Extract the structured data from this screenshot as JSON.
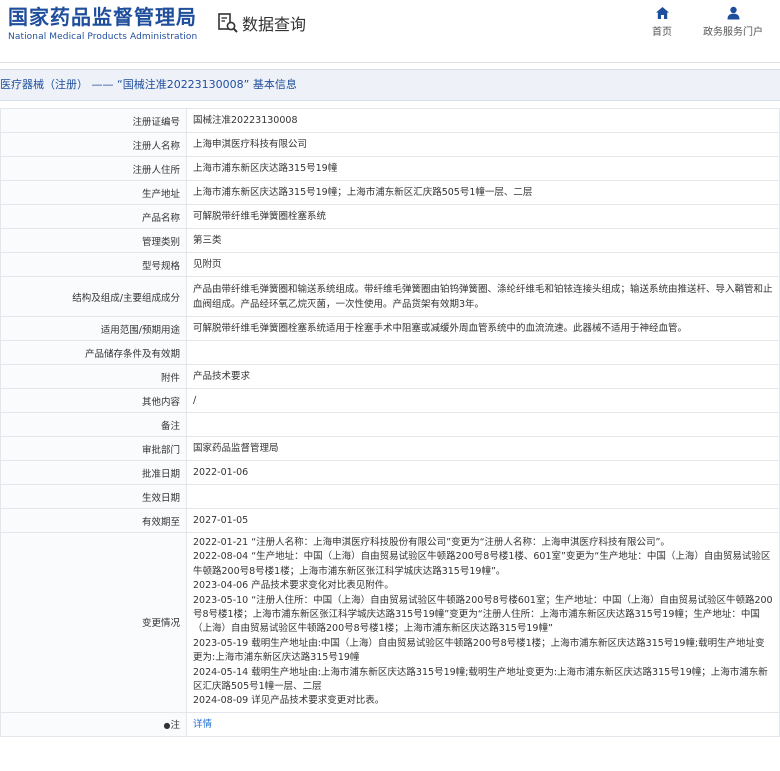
{
  "header": {
    "logo_cn": "国家药品监督管理局",
    "logo_en": "National Medical Products Administration",
    "query_title": "数据查询",
    "nav": [
      {
        "label": "首页",
        "icon": "home-icon"
      },
      {
        "label": "政务服务门户",
        "icon": "user-icon"
      }
    ]
  },
  "breadcrumb": "医疗器械（注册） —— “国械注准20223130008” 基本信息",
  "colors": {
    "brand": "#1f4e9c",
    "link": "#1f6fd1",
    "breadcrumb_bg": "#eef2f8"
  },
  "rows": [
    {
      "label": "注册证编号",
      "value": "国械注准20223130008"
    },
    {
      "label": "注册人名称",
      "value": "上海申淇医疗科技有限公司"
    },
    {
      "label": "注册人住所",
      "value": "上海市浦东新区庆达路315号19幢"
    },
    {
      "label": "生产地址",
      "value": "上海市浦东新区庆达路315号19幢；上海市浦东新区汇庆路505号1幢一层、二层"
    },
    {
      "label": "产品名称",
      "value": "可解脱带纤维毛弹簧圈栓塞系统"
    },
    {
      "label": "管理类别",
      "value": "第三类"
    },
    {
      "label": "型号规格",
      "value": "见附页"
    },
    {
      "label": "结构及组成/主要组成成分",
      "value": "产品由带纤维毛弹簧圈和输送系统组成。带纤维毛弹簧圈由铂钨弹簧圈、涤纶纤维毛和铂铱连接头组成；输送系统由推送杆、导入鞘管和止血阀组成。产品经环氧乙烷灭菌，一次性使用。产品货架有效期3年。"
    },
    {
      "label": "适用范围/预期用途",
      "value": "可解脱带纤维毛弹簧圈栓塞系统适用于栓塞手术中阻塞或减缓外周血管系统中的血流流速。此器械不适用于神经血管。"
    },
    {
      "label": "产品储存条件及有效期",
      "value": ""
    },
    {
      "label": "附件",
      "value": "产品技术要求"
    },
    {
      "label": "其他内容",
      "value": "/"
    },
    {
      "label": "备注",
      "value": ""
    },
    {
      "label": "审批部门",
      "value": "国家药品监督管理局"
    },
    {
      "label": "批准日期",
      "value": "2022-01-06"
    },
    {
      "label": "生效日期",
      "value": ""
    },
    {
      "label": "有效期至",
      "value": "2027-01-05"
    }
  ],
  "change_label": "变更情况",
  "changes": [
    "2022-01-21 “注册人名称：上海申淇医疗科技股份有限公司”变更为“注册人名称：上海申淇医疗科技有限公司”。",
    "2022-08-04 “生产地址：中国（上海）自由贸易试验区牛顿路200号8号楼1楼、601室”变更为“生产地址：中国（上海）自由贸易试验区牛顿路200号8号楼1楼；上海市浦东新区张江科学城庆达路315号19幢”。",
    "2023-04-06 产品技术要求变化对比表见附件。",
    "2023-05-10 “注册人住所：中国（上海）自由贸易试验区牛顿路200号8号楼601室；生产地址：中国（上海）自由贸易试验区牛顿路200号8号楼1楼；上海市浦东新区张江科学城庆达路315号19幢”变更为“注册人住所：上海市浦东新区庆达路315号19幢；生产地址：中国（上海）自由贸易试验区牛顿路200号8号楼1楼；上海市浦东新区庆达路315号19幢”",
    "2023-05-19 载明生产地址由:中国（上海）自由贸易试验区牛顿路200号8号楼1楼；上海市浦东新区庆达路315号19幢;载明生产地址变更为:上海市浦东新区庆达路315号19幢",
    "2024-05-14 载明生产地址由:上海市浦东新区庆达路315号19幢;载明生产地址变更为:上海市浦东新区庆达路315号19幢；上海市浦东新区汇庆路505号1幢一层、二层",
    "2024-08-09 详见产品技术要求变更对比表。"
  ],
  "note": {
    "label": "注",
    "link": "详情"
  }
}
